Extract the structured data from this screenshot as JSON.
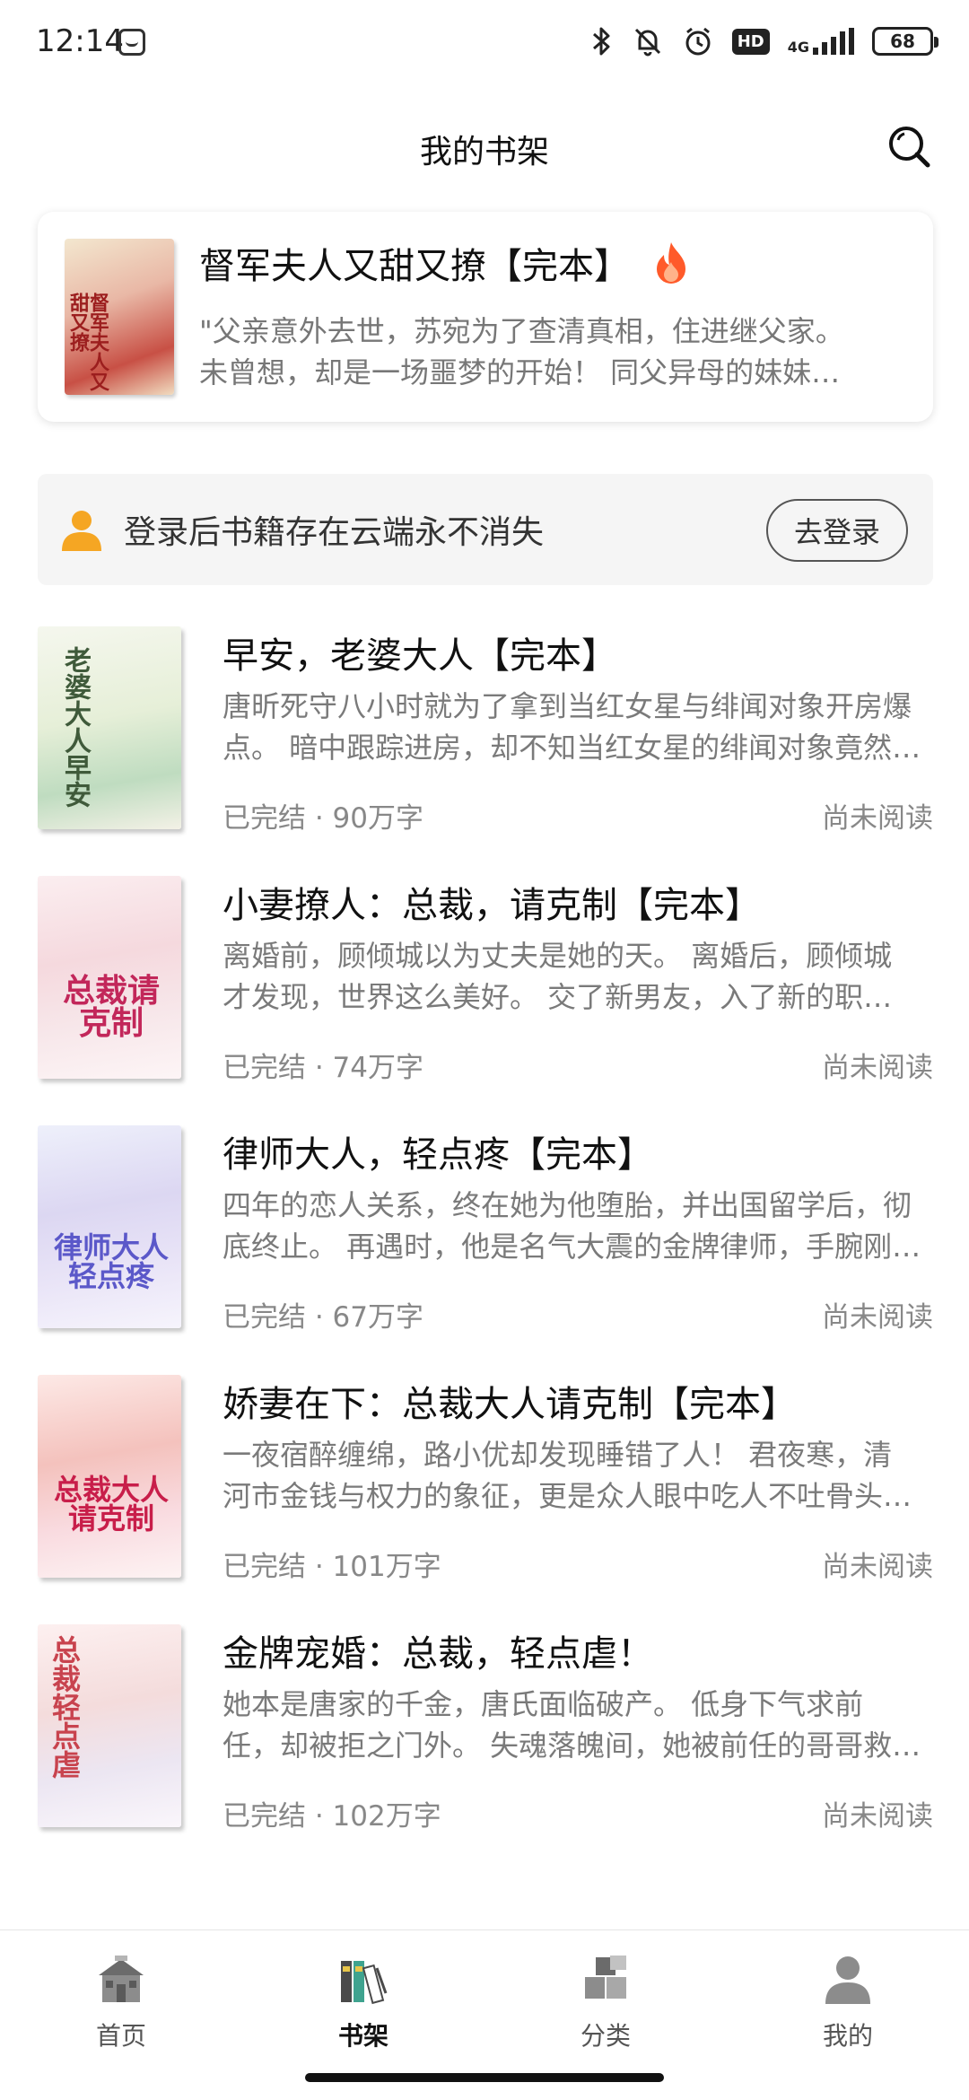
{
  "status_bar": {
    "time": "12:14",
    "network": "4G",
    "hd_badge": "HD",
    "battery": "68"
  },
  "header": {
    "title": "我的书架"
  },
  "featured": {
    "title": "督军夫人又甜又撩【完本】",
    "desc_line1": "\"父亲意外去世，苏宛为了查清真相，住进继父家。",
    "desc_line2": "未曾想，却是一场噩梦的开始！ 同父异母的妹妹…",
    "cover_text": "督军夫人又甜又撩"
  },
  "login_bar": {
    "text": "登录后书籍存在云端永不消失",
    "button": "去登录"
  },
  "books": [
    {
      "title": "早安，老婆大人【完本】",
      "desc_line1": "唐昕死守八小时就为了拿到当红女星与绯闻对象开房爆",
      "desc_line2": "点。 暗中跟踪进房，却不知当红女星的绯闻对象竟然…",
      "meta": "已完结 · 90万字",
      "status": "尚未阅读",
      "cover_text": "老婆大人早安"
    },
    {
      "title": "小妻撩人：总裁，请克制【完本】",
      "desc_line1": "离婚前，顾倾城以为丈夫是她的天。 离婚后，顾倾城",
      "desc_line2": "才发现，世界这么美好。 交了新男友，入了新的职…",
      "meta": "已完结 · 74万字",
      "status": "尚未阅读",
      "cover_text": "总裁请克制"
    },
    {
      "title": "律师大人，轻点疼【完本】",
      "desc_line1": "四年的恋人关系，终在她为他堕胎，并出国留学后，彻",
      "desc_line2": "底终止。 再遇时，他是名气大震的金牌律师，手腕刚…",
      "meta": "已完结 · 67万字",
      "status": "尚未阅读",
      "cover_text": "律师大人轻点疼"
    },
    {
      "title": "娇妻在下：总裁大人请克制【完本】",
      "desc_line1": "一夜宿醉缠绵，路小优却发现睡错了人！ 君夜寒，清",
      "desc_line2": "河市金钱与权力的象征，更是众人眼中吃人不吐骨头…",
      "meta": "已完结 · 101万字",
      "status": "尚未阅读",
      "cover_text": "总裁大人请克制"
    },
    {
      "title": "金牌宠婚：总裁，轻点虐！",
      "desc_line1": "她本是唐家的千金，唐氏面临破产。 低身下气求前",
      "desc_line2": "任，却被拒之门外。 失魂落魄间，她被前任的哥哥救…",
      "meta": "已完结 · 102万字",
      "status": "尚未阅读",
      "cover_text": "总裁轻点虐"
    }
  ],
  "bottom_nav": {
    "home": "首页",
    "bookshelf": "书架",
    "category": "分类",
    "mine": "我的"
  },
  "colors": {
    "accent_orange": "#F5A623",
    "fire": "#FF5A2A",
    "text_primary": "#111111",
    "text_secondary": "#7A7A7A"
  }
}
